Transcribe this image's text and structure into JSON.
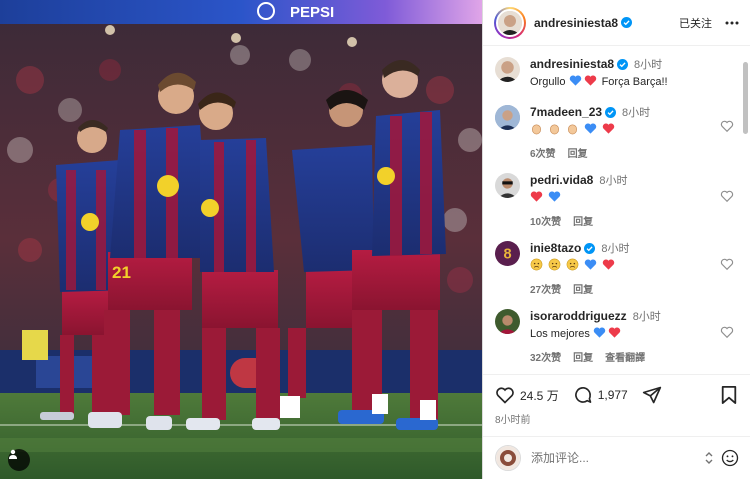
{
  "photo": {
    "banner_text": "PEPSI",
    "jersey_number": "21"
  },
  "header": {
    "username": "andresiniesta8",
    "follow_status": "已关注",
    "more_icon": "more-horizontal-icon"
  },
  "comments": [
    {
      "username": "andresiniesta8",
      "verified": true,
      "time": "8小时",
      "text_pre": "Orgullo ",
      "emojis_mid": [
        "blue-heart",
        "red-heart"
      ],
      "text_post": " Força Barça!!",
      "is_caption": true
    },
    {
      "username": "7madeen_23",
      "verified": true,
      "time": "8小时",
      "emojis": [
        "clap",
        "clap",
        "clap",
        "blue-heart",
        "red-heart"
      ],
      "likes": "6次赞",
      "reply": "回复"
    },
    {
      "username": "pedri.vida8",
      "verified": false,
      "time": "8小时",
      "emojis": [
        "red-heart",
        "blue-heart"
      ],
      "likes": "10次赞",
      "reply": "回复"
    },
    {
      "username": "inie8tazo",
      "verified": true,
      "time": "8小时",
      "emojis": [
        "sad",
        "sad",
        "sad",
        "blue-heart",
        "red-heart"
      ],
      "likes": "27次赞",
      "reply": "回复"
    },
    {
      "username": "isoraroddriguezz",
      "verified": false,
      "time": "8小时",
      "text": "Los mejores ",
      "emojis_after": [
        "blue-heart",
        "red-heart"
      ],
      "likes": "32次赞",
      "reply": "回复",
      "view_translation": "查看翻譯"
    }
  ],
  "actions": {
    "likes_count": "24.5 万",
    "comments_count": "1,977",
    "post_time": "8小时前"
  },
  "add_comment": {
    "placeholder": "添加评论..."
  },
  "colors": {
    "blue_heart": "#3b8df5",
    "red_heart": "#ed3b4a",
    "verified": "#0095f6",
    "barca_blue": "#1f3e8c",
    "barca_red": "#a3163a"
  }
}
